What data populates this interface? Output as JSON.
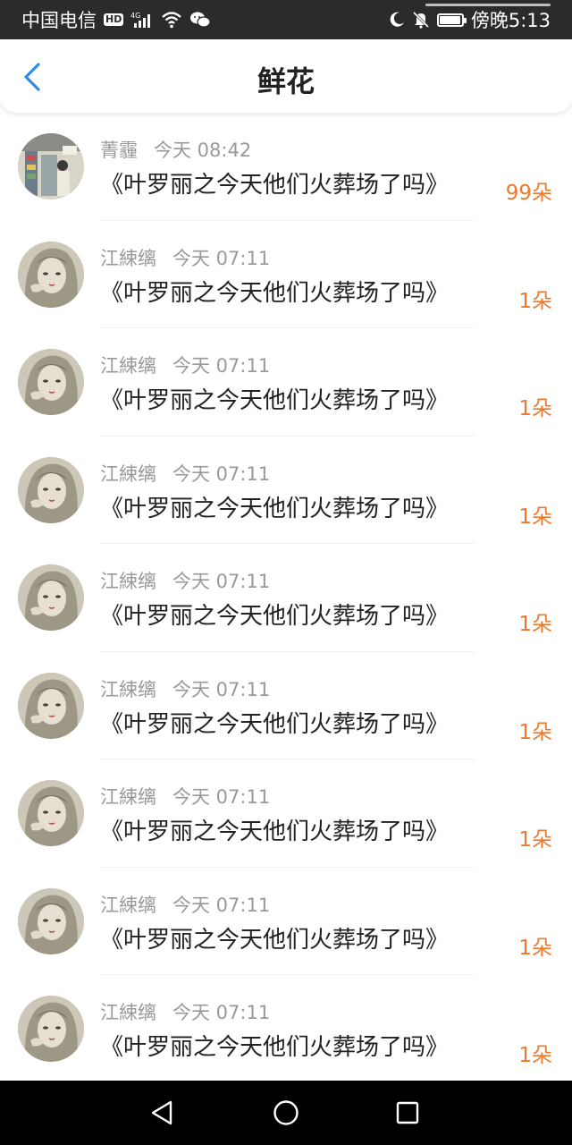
{
  "status_bar": {
    "carrier": "中国电信",
    "hd": "HD",
    "network": "4G",
    "time": "傍晚5:13",
    "battery_level": 0.9,
    "icons": [
      "hd-icon",
      "signal-icon",
      "wifi-icon",
      "wechat-icon",
      "moon-icon",
      "bell-off-icon",
      "battery-icon"
    ]
  },
  "header": {
    "title": "鲜花",
    "back_icon": "back-arrow-icon",
    "accent": "#2f8ce8"
  },
  "list": {
    "count_color": "#ea7a2e",
    "items": [
      {
        "name": "菁霾",
        "time": "今天 08:42",
        "message": "《叶罗丽之今天他们火葬场了吗》",
        "count": "99朵",
        "avatar": "photo-avatar"
      },
      {
        "name": "江綀缡",
        "time": "今天 07:11",
        "message": "《叶罗丽之今天他们火葬场了吗》",
        "count": "1朵",
        "avatar": "illustration-avatar"
      },
      {
        "name": "江綀缡",
        "time": "今天 07:11",
        "message": "《叶罗丽之今天他们火葬场了吗》",
        "count": "1朵",
        "avatar": "illustration-avatar"
      },
      {
        "name": "江綀缡",
        "time": "今天 07:11",
        "message": "《叶罗丽之今天他们火葬场了吗》",
        "count": "1朵",
        "avatar": "illustration-avatar"
      },
      {
        "name": "江綀缡",
        "time": "今天 07:11",
        "message": "《叶罗丽之今天他们火葬场了吗》",
        "count": "1朵",
        "avatar": "illustration-avatar"
      },
      {
        "name": "江綀缡",
        "time": "今天 07:11",
        "message": "《叶罗丽之今天他们火葬场了吗》",
        "count": "1朵",
        "avatar": "illustration-avatar"
      },
      {
        "name": "江綀缡",
        "time": "今天 07:11",
        "message": "《叶罗丽之今天他们火葬场了吗》",
        "count": "1朵",
        "avatar": "illustration-avatar"
      },
      {
        "name": "江綀缡",
        "time": "今天 07:11",
        "message": "《叶罗丽之今天他们火葬场了吗》",
        "count": "1朵",
        "avatar": "illustration-avatar"
      },
      {
        "name": "江綀缡",
        "time": "今天 07:11",
        "message": "《叶罗丽之今天他们火葬场了吗》",
        "count": "1朵",
        "avatar": "illustration-avatar"
      }
    ]
  },
  "nav_bar": {
    "icons": [
      "back-triangle-icon",
      "home-circle-icon",
      "recents-square-icon"
    ]
  }
}
